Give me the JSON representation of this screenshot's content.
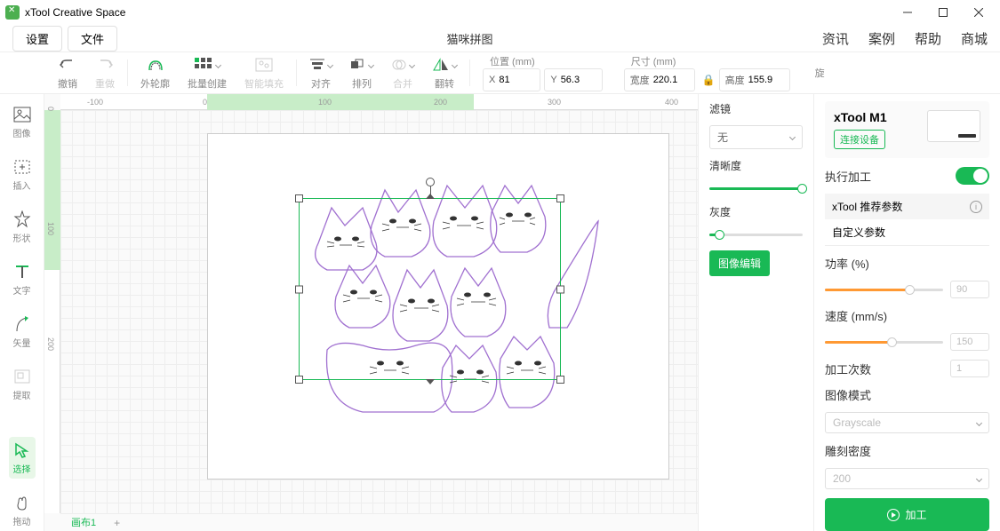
{
  "app_title": "xTool Creative Space",
  "document_title": "猫咪拼图",
  "menu": {
    "settings": "设置",
    "file": "文件"
  },
  "topnav": {
    "news": "资讯",
    "cases": "案例",
    "help": "帮助",
    "store": "商城"
  },
  "toolbar": {
    "undo": "撤销",
    "redo": "重做",
    "outline": "外轮廓",
    "batch": "批量创建",
    "smartfill": "智能填充",
    "align": "对齐",
    "arrange": "排列",
    "combine": "合并",
    "flip": "翻转",
    "pos_label": "位置 (mm)",
    "size_label": "尺寸 (mm)",
    "rotate_label": "旋",
    "x_prefix": "X",
    "y_prefix": "Y",
    "w_prefix": "宽度",
    "h_prefix": "高度",
    "x": "81",
    "y": "56.3",
    "w": "220.1",
    "h": "155.9"
  },
  "left_tools": {
    "image": "图像",
    "insert": "插入",
    "shape": "形状",
    "text": "文字",
    "vector": "矢量",
    "extract": "提取",
    "select": "选择",
    "drag": "拖动"
  },
  "canvas": {
    "tab1": "画布1",
    "ruler_h": [
      "-100",
      "0",
      "100",
      "200",
      "300",
      "400"
    ],
    "ruler_v": [
      "0",
      "100",
      "200"
    ]
  },
  "filter": {
    "title": "滤镜",
    "none": "无",
    "sharpness": "清晰度",
    "gray": "灰度",
    "edit_btn": "图像编辑"
  },
  "right": {
    "device_name": "xTool M1",
    "connect": "连接设备",
    "process_exec": "执行加工",
    "rec_tab": "xTool 推荐参数",
    "custom_tab": "自定义参数",
    "power": "功率 (%)",
    "power_val": "90",
    "speed": "速度 (mm/s)",
    "speed_val": "150",
    "passes": "加工次数",
    "passes_val": "1",
    "img_mode": "图像模式",
    "img_mode_val": "Grayscale",
    "density": "雕刻密度",
    "density_val": "200",
    "process_btn": "加工"
  }
}
